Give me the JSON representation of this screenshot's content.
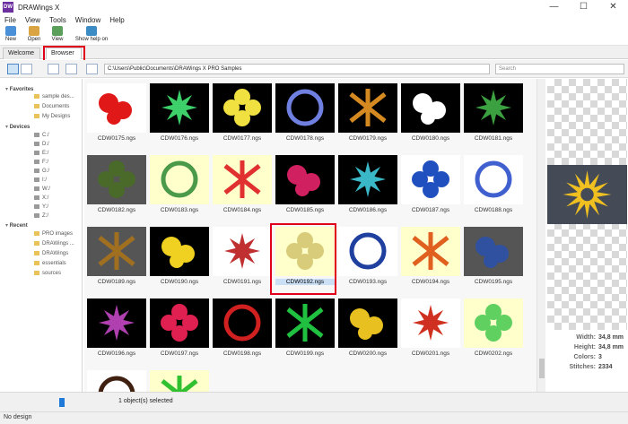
{
  "window": {
    "title": "DRAWings X",
    "logo_text": "DW"
  },
  "window_controls": {
    "minimize": "—",
    "maximize": "☐",
    "close": "✕"
  },
  "menu": [
    "File",
    "View",
    "Tools",
    "Window",
    "Help"
  ],
  "toolbar": [
    {
      "label": "New",
      "icon": "new-doc-icon",
      "color": "#4a90d9"
    },
    {
      "label": "Open",
      "icon": "open-folder-icon",
      "color": "#d9a441"
    },
    {
      "label": "View",
      "icon": "view-icon",
      "color": "#5aa05a"
    },
    {
      "label": "Show help on",
      "icon": "help-pointer-icon",
      "color": "#3b8bc4"
    }
  ],
  "tabs": [
    {
      "label": "Welcome",
      "close": "×"
    },
    {
      "label": "Browser",
      "close": "×"
    }
  ],
  "path": "C:\\Users\\Public\\Documents\\DRAWings X PRO Samples",
  "search_placeholder": "Search",
  "tree": {
    "favorites_label": "Favorites",
    "favorites": [
      "sample des...",
      "Documents",
      "My Designs"
    ],
    "devices_label": "Devices",
    "devices": [
      "C:/",
      "D:/",
      "E:/",
      "F:/",
      "G:/",
      "I:/",
      "W:/",
      "X:/",
      "Y:/",
      "Z:/"
    ],
    "recent_label": "Recent",
    "recent": [
      "PRO images",
      "DRAWings ...",
      "DRAWings",
      "essentials",
      "sources"
    ]
  },
  "grid": {
    "rows": [
      [
        "CDW0175.ngs",
        "CDW0176.ngs",
        "CDW0177.ngs",
        "CDW0178.ngs",
        "CDW0179.ngs",
        "CDW0180.ngs",
        "CDW0181.ngs"
      ],
      [
        "CDW0182.ngs",
        "CDW0183.ngs",
        "CDW0184.ngs",
        "CDW0185.ngs",
        "CDW0186.ngs",
        "CDW0187.ngs",
        "CDW0188.ngs"
      ],
      [
        "CDW0189.ngs",
        "CDW0190.ngs",
        "CDW0191.ngs",
        "CDW0192.ngs",
        "CDW0193.ngs",
        "CDW0194.ngs",
        "CDW0195.ngs"
      ],
      [
        "CDW0196.ngs",
        "CDW0197.ngs",
        "CDW0198.ngs",
        "CDW0199.ngs",
        "CDW0200.ngs",
        "CDW0201.ngs",
        "CDW0202.ngs"
      ],
      [
        "",
        ""
      ]
    ],
    "thumb_bg": [
      [
        "#ffffff",
        "#000000",
        "#000000",
        "#000000",
        "#000000",
        "#000000",
        "#000000"
      ],
      [
        "#555555",
        "#ffffcc",
        "#ffffcc",
        "#000000",
        "#000000",
        "#ffffff",
        "#ffffff"
      ],
      [
        "#555555",
        "#000000",
        "#ffffff",
        "#ffffcc",
        "#ffffff",
        "#ffffcc",
        "#555555"
      ],
      [
        "#000000",
        "#000000",
        "#000000",
        "#000000",
        "#000000",
        "#ffffff",
        "#ffffcc"
      ],
      [
        "#ffffff",
        "#ffffcc"
      ]
    ],
    "thumb_motif": [
      [
        "#e01818",
        "#3ccf6a",
        "#f0e040",
        "#7080e0",
        "#d48a20",
        "#ffffff",
        "#3aa040"
      ],
      [
        "#4a6a2a",
        "#4a9a4a",
        "#e03030",
        "#d02060",
        "#3ab8c8",
        "#2050c0",
        "#4060d0"
      ],
      [
        "#a07020",
        "#f0d020",
        "#c03030",
        "#d8cc7a",
        "#2040a0",
        "#e06020",
        "#3050a0"
      ],
      [
        "#b040b0",
        "#e02050",
        "#d02020",
        "#20c040",
        "#e8c020",
        "#d03020",
        "#60d060"
      ],
      [
        "#402010",
        "#30c030"
      ]
    ],
    "selected_label": "CDW0192.ngs"
  },
  "preview": {
    "bg": "#444b57",
    "motif": "#f0c020",
    "width_label": "Width:",
    "width_value": "34,8 mm",
    "height_label": "Height:",
    "height_value": "34,8 mm",
    "colors_label": "Colors:",
    "colors_value": "3",
    "stitches_label": "Stitches:",
    "stitches_value": "2334"
  },
  "selection_status": "1 object(s) selected",
  "status": "No design"
}
